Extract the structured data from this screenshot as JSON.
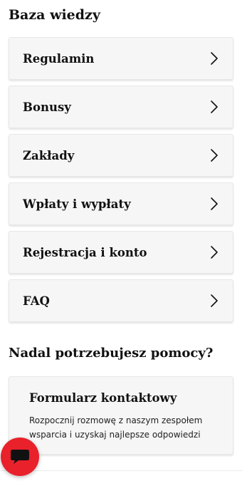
{
  "knowledge_base": {
    "title": "Baza wiedzy",
    "items": [
      {
        "label": "Regulamin",
        "icon": "chevron-right-icon"
      },
      {
        "label": "Bonusy",
        "icon": "chevron-right-icon"
      },
      {
        "label": "Zakłady",
        "icon": "chevron-right-icon"
      },
      {
        "label": "Wpłaty i wypłaty",
        "icon": "chevron-right-icon"
      },
      {
        "label": "Rejestracja i konto",
        "icon": "chevron-right-icon"
      },
      {
        "label": "FAQ",
        "icon": "chevron-right-icon"
      }
    ]
  },
  "help": {
    "title": "Nadal potrzebujesz pomocy?",
    "contact_card": {
      "title": "Formularz kontaktowy",
      "description": "Rozpocznij rozmowę z naszym zespołem wsparcia i uzyskaj najlepsze odpowiedzi"
    }
  },
  "chat_button": {
    "icon": "chat-bubble-icon",
    "color": "#e8212b"
  },
  "colors": {
    "card_bg": "#f6f6f6",
    "text": "#111111",
    "accent": "#e8212b"
  }
}
